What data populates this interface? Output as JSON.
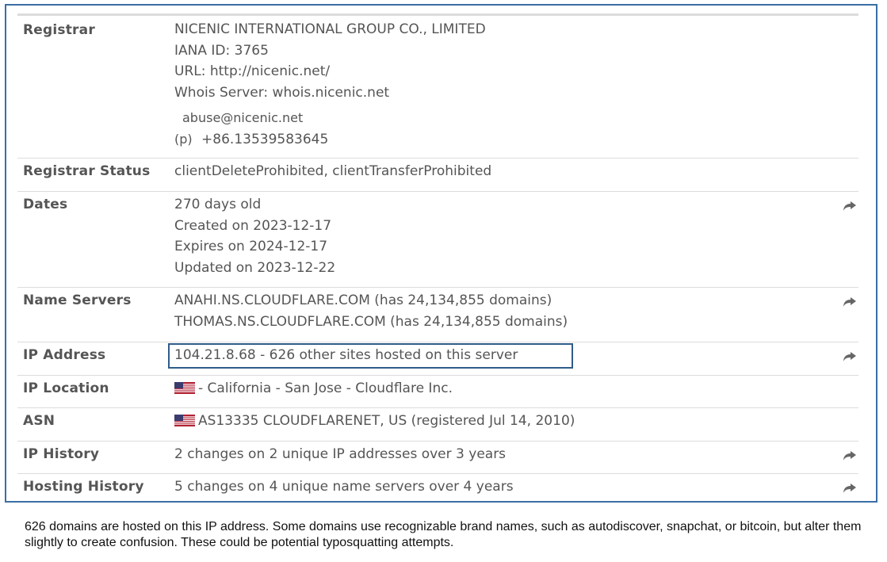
{
  "rows": {
    "registrar": {
      "label": "Registrar",
      "name": "NICENIC INTERNATIONAL GROUP CO., LIMITED",
      "iana": "IANA ID: 3765",
      "url": "URL: http://nicenic.net/",
      "whois": "Whois Server: whois.nicenic.net",
      "email": "abuse@nicenic.net",
      "phone_prefix": "(p)",
      "phone": "+86.13539583645"
    },
    "status": {
      "label": "Registrar Status",
      "value": "clientDeleteProhibited, clientTransferProhibited"
    },
    "dates": {
      "label": "Dates",
      "age": "270 days old",
      "created": "Created on 2023-12-17",
      "expires": "Expires on 2024-12-17",
      "updated": "Updated on 2023-12-22"
    },
    "name_servers": {
      "label": "Name Servers",
      "ns1": "ANAHI.NS.CLOUDFLARE.COM (has 24,134,855 domains)",
      "ns2": "THOMAS.NS.CLOUDFLARE.COM (has 24,134,855 domains)"
    },
    "ip_address": {
      "label": "IP Address",
      "value": "104.21.8.68 - 626 other sites hosted on this server"
    },
    "ip_location": {
      "label": "IP Location",
      "value": "- California - San Jose - Cloudflare Inc."
    },
    "asn": {
      "label": "ASN",
      "value": "AS13335 CLOUDFLARENET, US (registered Jul 14, 2010)"
    },
    "ip_history": {
      "label": "IP History",
      "value": "2 changes on 2 unique IP addresses over 3 years"
    },
    "hosting_history": {
      "label": "Hosting History",
      "value": "5 changes on 4 unique name servers over 4 years"
    }
  },
  "icons": {
    "arrow": "share-arrow-icon",
    "flag": "us-flag-icon"
  },
  "colors": {
    "panel_border": "#3a6ea5",
    "highlight_border": "#2f5d8a",
    "text": "#555555",
    "divider": "#dcdcdc"
  },
  "caption": "626 domains are hosted on this IP address. Some domains use recognizable brand names, such as autodiscover, snapchat, or bitcoin, but alter them slightly to create confusion. These could be potential typosquatting attempts."
}
